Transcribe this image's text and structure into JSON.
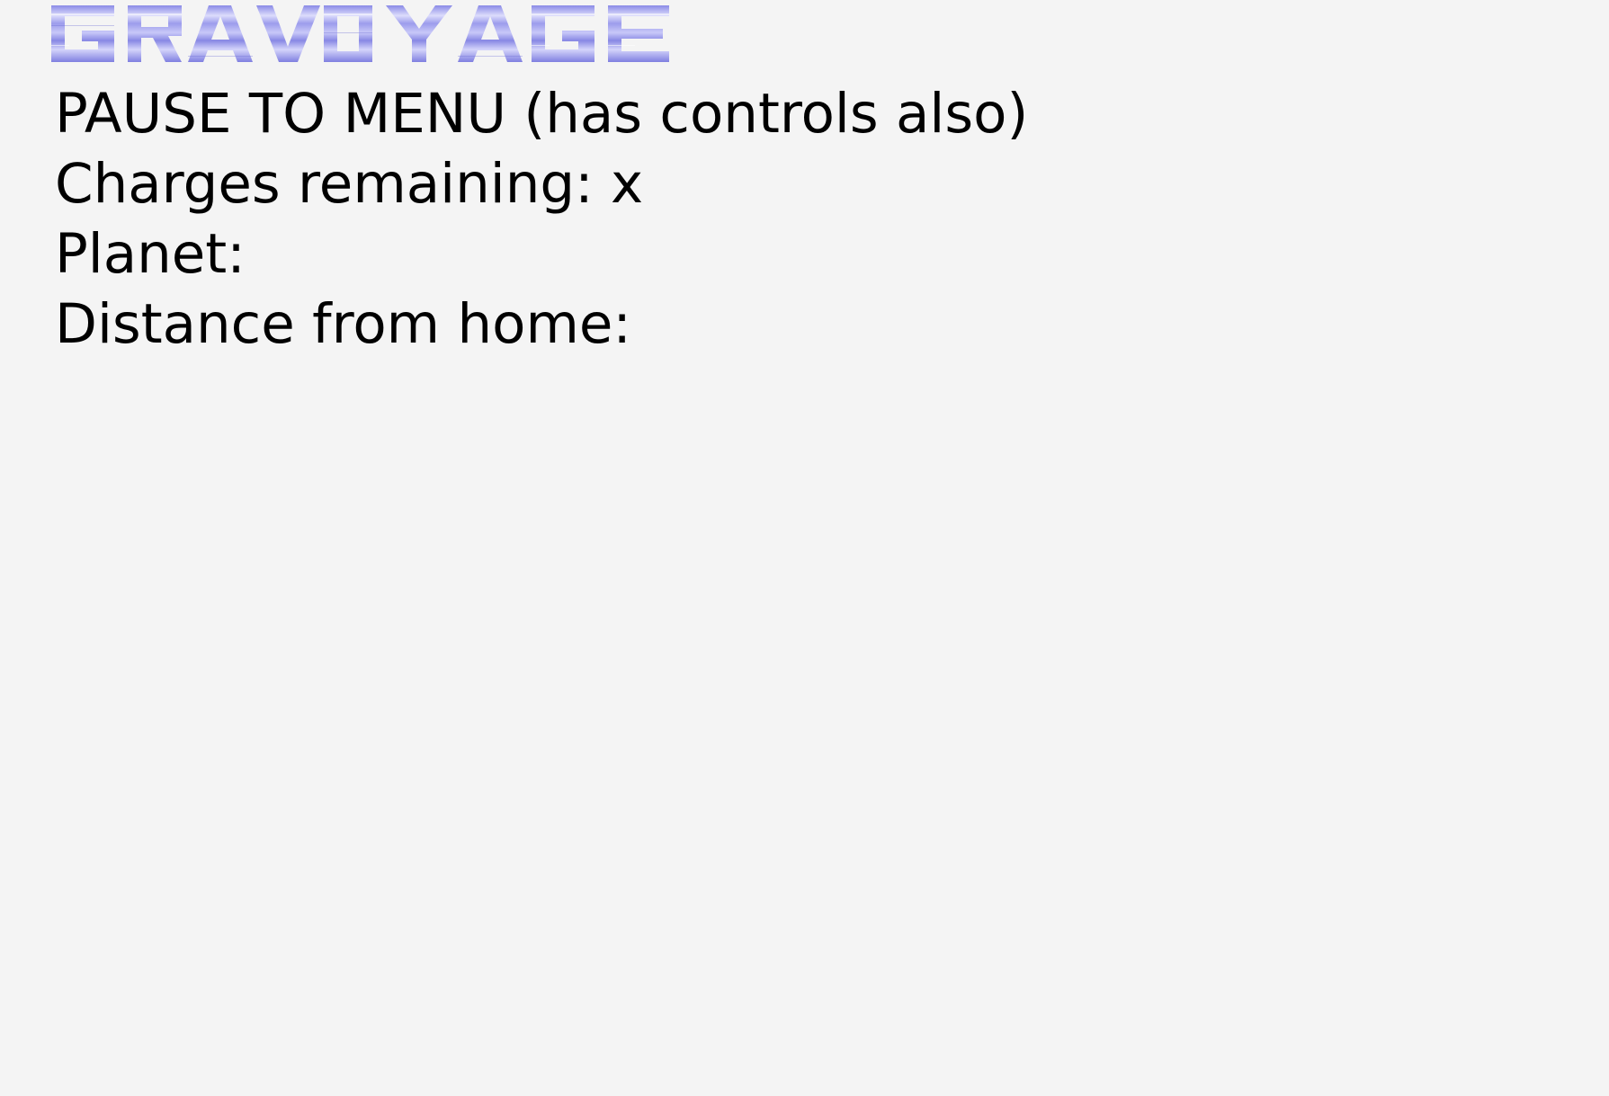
{
  "game": {
    "logo_text": "GRAVOYAGE",
    "logo_colors": {
      "light": "#d8d8fb",
      "mid": "#a9a9ef",
      "dark": "#7f7fe0"
    }
  },
  "hud": {
    "pause_text": "PAUSE TO MENU (has controls also)",
    "charges_label": "Charges remaining:",
    "charges_value": "x",
    "planet_label": "Planet:",
    "planet_value": "",
    "distance_label": "Distance from home:",
    "distance_value": ""
  }
}
